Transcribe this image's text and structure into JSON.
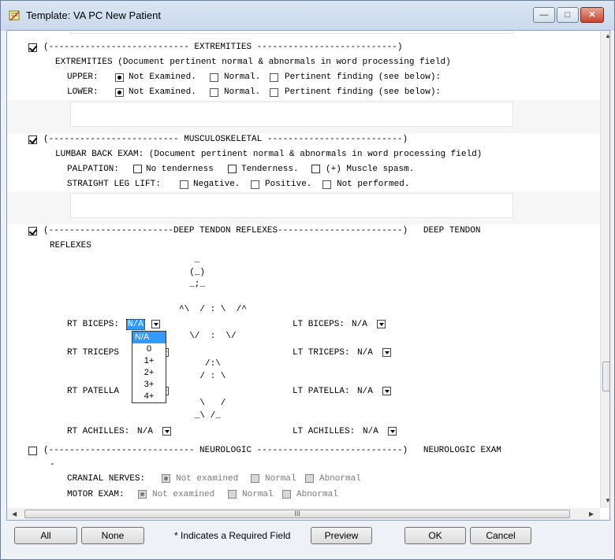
{
  "window": {
    "title": "Template: VA PC New Patient"
  },
  "extremities": {
    "header": "(--------------------------- EXTREMITIES ---------------------------)",
    "line1": "EXTREMITIES (Document pertinent normal & abnormals in word processing field)",
    "upper_label": "UPPER:",
    "lower_label": "LOWER:",
    "opt_not_examined": "Not Examined.",
    "opt_normal": "Normal.",
    "opt_pertinent": "Pertinent finding (see below):"
  },
  "musculoskeletal": {
    "header": "(------------------------- MUSCULOSKELETAL --------------------------)",
    "line1": "LUMBAR BACK EXAM: (Document pertinent normal & abnormals in word processing field)",
    "palpation_label": "PALPATION:",
    "opt_no_tenderness": "No tenderness",
    "opt_tenderness": "Tenderness.",
    "opt_spasm": "(+) Muscle spasm.",
    "slr_label": "STRAIGHT LEG LIFT:",
    "opt_negative": "Negative.",
    "opt_positive": "Positive.",
    "opt_not_performed": "Not performed."
  },
  "dtr": {
    "header": "(------------------------DEEP TENDON REFLEXES------------------------)   DEEP TENDON",
    "header2": "REFLEXES",
    "figure": [
      "   _",
      "  (_)",
      "  _;_",
      "",
      "^\\  / : \\  /^",
      "",
      "  \\/  :  \\/",
      "",
      "     /:\\",
      "    / : \\",
      "",
      "    \\   /",
      "   _\\ /_"
    ],
    "rt_biceps": "RT BICEPS:",
    "rt_triceps": "RT TRICEPS",
    "rt_patella": "RT PATELLA",
    "rt_achilles": "RT ACHILLES:",
    "lt_biceps": "LT BICEPS:",
    "lt_triceps": "LT TRICEPS:",
    "lt_patella": "LT PATELLA:",
    "lt_achilles": "LT ACHILLES:",
    "value_na": "N/A",
    "dropdown_options": [
      "N/A",
      "0",
      "1+",
      "2+",
      "3+",
      "4+"
    ]
  },
  "neurologic": {
    "header": "(---------------------------- NEUROLOGIC ----------------------------)   NEUROLOGIC EXAM",
    "dash": "-",
    "cranial_label": "CRANIAL NERVES:",
    "motor_label": "MOTOR EXAM:",
    "opt_not_examined": "Not examined",
    "opt_normal": "Normal",
    "opt_abnormal": "Abnormal"
  },
  "hscroll_label": "III",
  "footer": {
    "all": "All",
    "none": "None",
    "required_note": "* Indicates a Required Field",
    "preview": "Preview",
    "ok": "OK",
    "cancel": "Cancel"
  }
}
